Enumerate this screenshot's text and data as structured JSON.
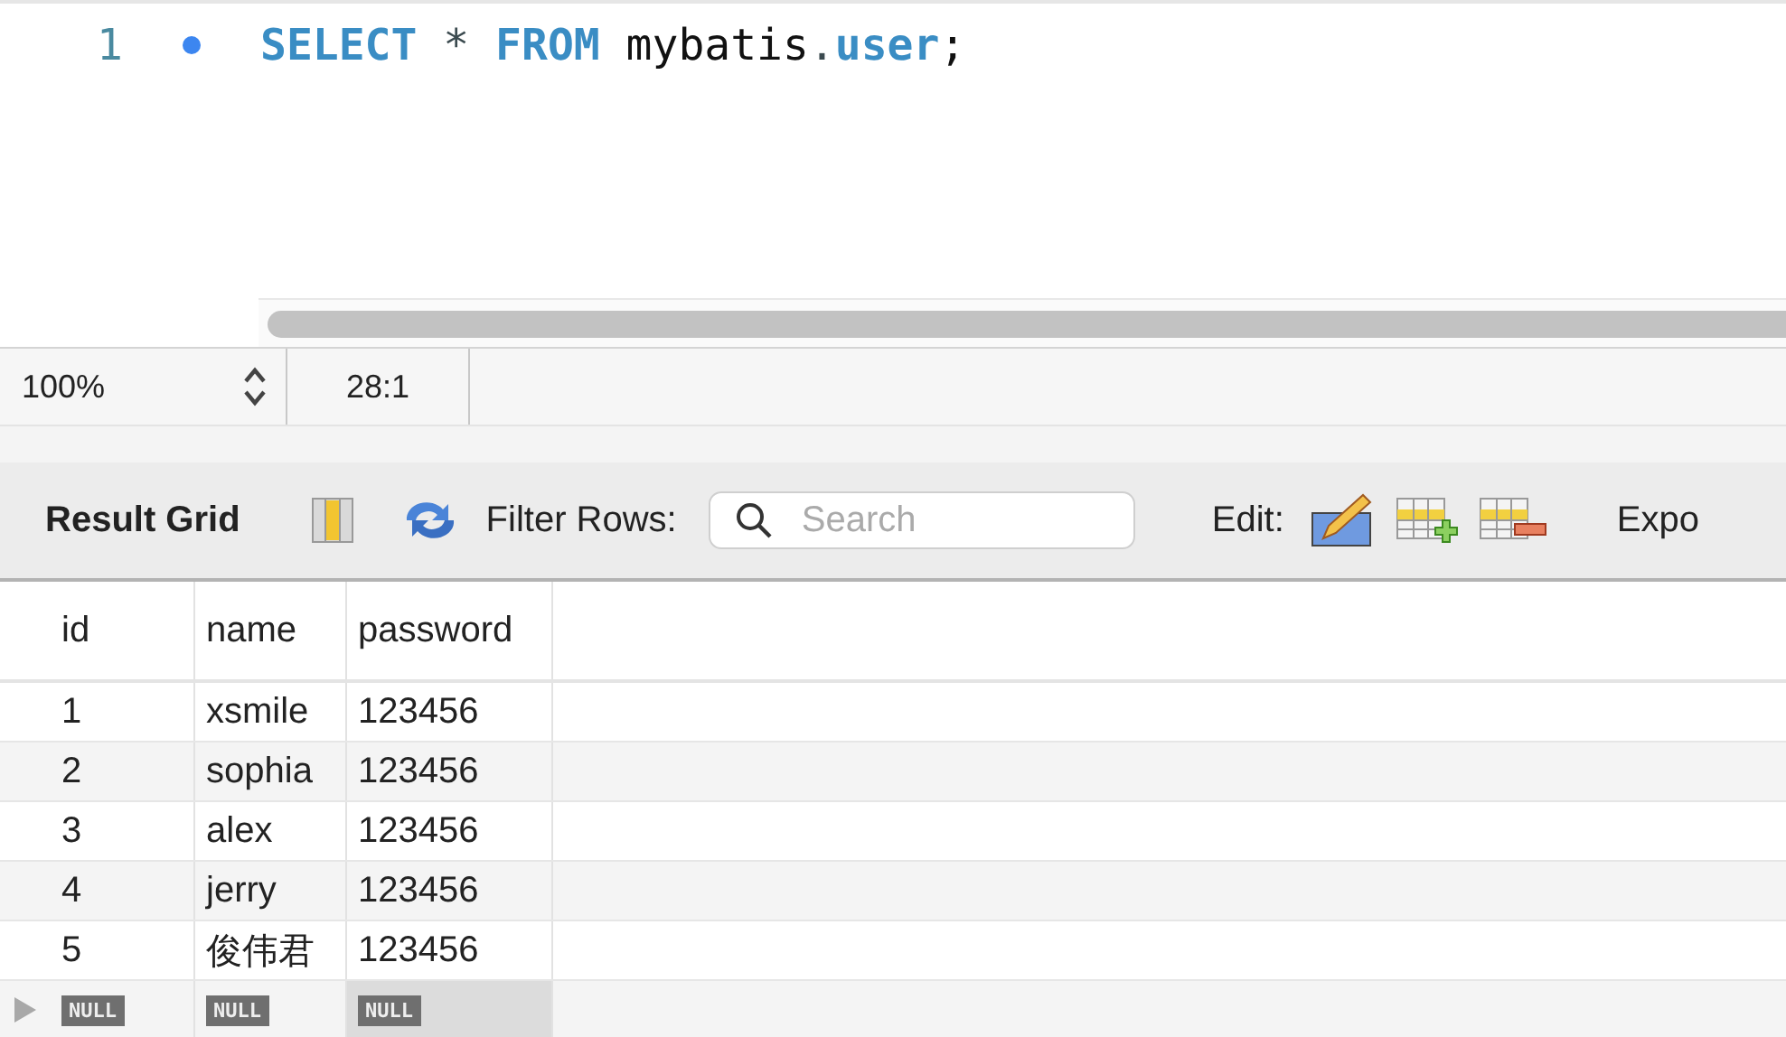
{
  "editor": {
    "lines": [
      {
        "number": "1",
        "breakpoint": true,
        "tokens": [
          {
            "text": "SELECT",
            "kind": "keyword"
          },
          {
            "text": " *",
            "kind": "operator"
          },
          {
            "text": " FROM",
            "kind": "keyword"
          },
          {
            "text": " mybatis",
            "kind": "plain"
          },
          {
            "text": ".",
            "kind": "operator"
          },
          {
            "text": "user",
            "kind": "keyword"
          },
          {
            "text": ";",
            "kind": "plain"
          }
        ]
      }
    ]
  },
  "status_bar": {
    "zoom": "100%",
    "position": "28:1"
  },
  "toolbar": {
    "title": "Result Grid",
    "filter_label": "Filter Rows:",
    "search": {
      "placeholder": "Search"
    },
    "edit_label": "Edit:",
    "export_label": "Expo"
  },
  "grid": {
    "columns": [
      "id",
      "name",
      "password"
    ],
    "rows": [
      {
        "current": false,
        "cells": [
          {
            "text": "1",
            "null": false,
            "selected": false
          },
          {
            "text": "xsmile",
            "null": false,
            "selected": false
          },
          {
            "text": "123456",
            "null": false,
            "selected": false
          }
        ]
      },
      {
        "current": false,
        "cells": [
          {
            "text": "2",
            "null": false,
            "selected": false
          },
          {
            "text": "sophia",
            "null": false,
            "selected": false
          },
          {
            "text": "123456",
            "null": false,
            "selected": false
          }
        ]
      },
      {
        "current": false,
        "cells": [
          {
            "text": "3",
            "null": false,
            "selected": false
          },
          {
            "text": "alex",
            "null": false,
            "selected": false
          },
          {
            "text": "123456",
            "null": false,
            "selected": false
          }
        ]
      },
      {
        "current": false,
        "cells": [
          {
            "text": "4",
            "null": false,
            "selected": false
          },
          {
            "text": "jerry",
            "null": false,
            "selected": false
          },
          {
            "text": "123456",
            "null": false,
            "selected": false
          }
        ]
      },
      {
        "current": false,
        "cells": [
          {
            "text": "5",
            "null": false,
            "selected": false
          },
          {
            "text": "俊伟君",
            "null": false,
            "selected": false
          },
          {
            "text": "123456",
            "null": false,
            "selected": false
          }
        ]
      },
      {
        "current": true,
        "cells": [
          {
            "text": "NULL",
            "null": true,
            "selected": false
          },
          {
            "text": "NULL",
            "null": true,
            "selected": false
          },
          {
            "text": "NULL",
            "null": true,
            "selected": true
          }
        ]
      }
    ]
  }
}
